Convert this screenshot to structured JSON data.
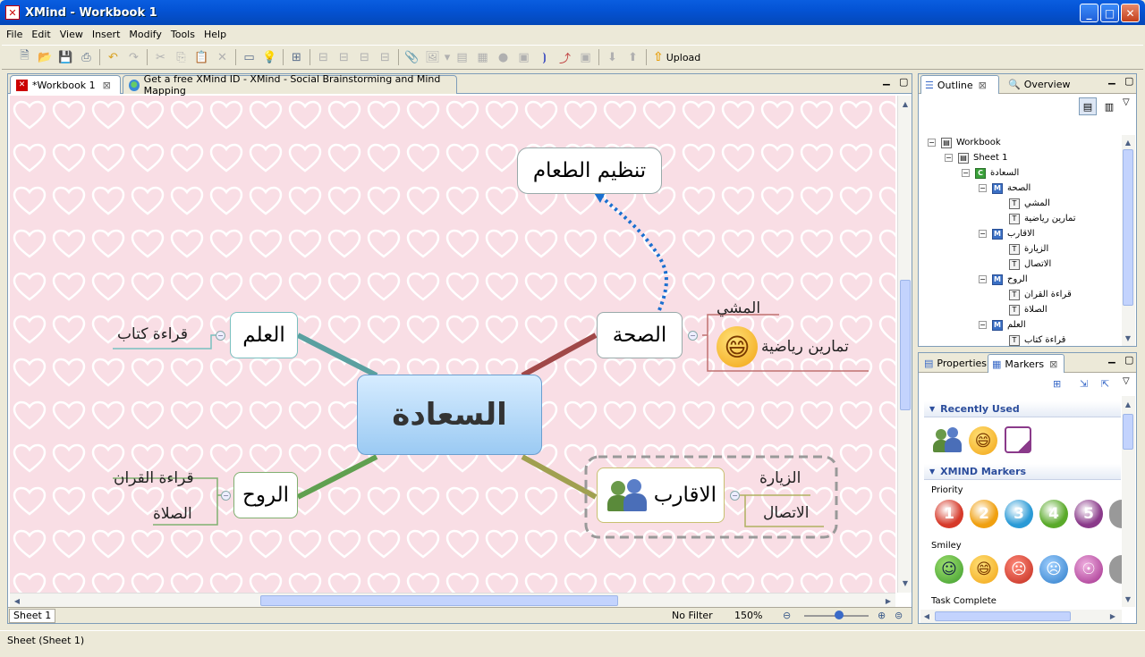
{
  "window": {
    "title": "XMind - Workbook 1",
    "icon": "xmind-app-icon"
  },
  "menu": [
    "File",
    "Edit",
    "View",
    "Insert",
    "Modify",
    "Tools",
    "Help"
  ],
  "toolbar": {
    "upload_label": "Upload"
  },
  "editor": {
    "tabs": [
      {
        "label": "*Workbook 1",
        "icon": "xmind-icon",
        "active": true
      },
      {
        "label": "Get a free XMind ID - XMind - Social Brainstorming and Mind Mapping",
        "icon": "globe-icon",
        "active": false
      }
    ],
    "sheet_tab": "Sheet 1",
    "filter": "No Filter",
    "zoom": "150%"
  },
  "mindmap": {
    "central": "السعادة",
    "health": {
      "label": "الصحة",
      "subs": [
        "المشي",
        "تمارين رياضية"
      ],
      "marker": "smiley-laugh-icon"
    },
    "knowledge": {
      "label": "العلم",
      "subs": [
        "قراءة كتاب"
      ]
    },
    "spirit": {
      "label": "الروح",
      "subs": [
        "قراءة القران",
        "الصلاة"
      ]
    },
    "family": {
      "label": "الاقارب",
      "subs": [
        "الزيارة",
        "الاتصال"
      ],
      "marker": "people-icon"
    },
    "floating": "تنظيم الطعام",
    "colors": {
      "background": "#f9dee5",
      "heart": "#ffffff",
      "relationship": "#1a6fd0"
    }
  },
  "outline": {
    "tab_label": "Outline",
    "tab2_label": "Overview",
    "tree": [
      {
        "label": "Workbook",
        "type": "workbook",
        "level": 0
      },
      {
        "label": "Sheet 1",
        "type": "sheet",
        "level": 1
      },
      {
        "label": "السعادة",
        "type": "C",
        "level": 2
      },
      {
        "label": "الصحة",
        "type": "M",
        "level": 3
      },
      {
        "label": "المشي",
        "type": "T",
        "level": 4
      },
      {
        "label": "تمارين رياضية",
        "type": "T",
        "level": 4
      },
      {
        "label": "الاقارب",
        "type": "M",
        "level": 3
      },
      {
        "label": "الزيارة",
        "type": "T",
        "level": 4
      },
      {
        "label": "الاتصال",
        "type": "T",
        "level": 4
      },
      {
        "label": "الروح",
        "type": "M",
        "level": 3
      },
      {
        "label": "قراءة القران",
        "type": "T",
        "level": 4
      },
      {
        "label": "الصلاة",
        "type": "T",
        "level": 4
      },
      {
        "label": "العلم",
        "type": "M",
        "level": 3
      },
      {
        "label": "قراءة كتاب",
        "type": "T",
        "level": 4
      }
    ]
  },
  "markers_panel": {
    "tab1": "Properties",
    "tab2": "Markers",
    "recently_used_title": "Recently Used",
    "recently_used": [
      "people-icon",
      "smiley-laugh-icon",
      "task-quarter-icon"
    ],
    "xmind_markers_title": "XMIND Markers",
    "priority_label": "Priority",
    "priority": [
      "1",
      "2",
      "3",
      "4",
      "5"
    ],
    "priority_colors": [
      "#d63a2a",
      "#f0a010",
      "#2a9ad6",
      "#5aaa2a",
      "#8a3a8a"
    ],
    "smiley_label": "Smiley",
    "smileys": [
      "smiley-smile-icon",
      "smiley-laugh-icon",
      "smiley-angry-icon",
      "smiley-cry-icon",
      "smiley-surprise-icon"
    ],
    "task_label": "Task Complete"
  },
  "statusbar": {
    "text": "Sheet (Sheet 1)"
  }
}
